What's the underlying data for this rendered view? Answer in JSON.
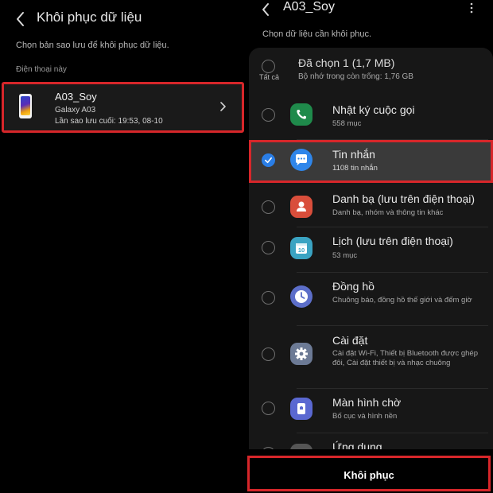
{
  "left": {
    "title": "Khôi phục dữ liệu",
    "subtitle": "Chọn bản sao lưu để khôi phục dữ liệu.",
    "section": "Điện thoại này",
    "device": {
      "name": "A03_Soy",
      "model": "Galaxy A03",
      "last_backup": "Lần sao lưu cuối: 19:53, 08-10"
    }
  },
  "right": {
    "title": "A03_Soy",
    "subtitle": "Chọn dữ liệu cần khôi phục.",
    "select_all": {
      "label": "Tất cả",
      "title": "Đã chọn 1 (1,7 MB)",
      "desc": "Bộ nhớ trong còn trống: 1,76 GB"
    },
    "items": [
      {
        "title": "Nhật ký cuộc gọi",
        "desc": "558 mục",
        "checked": false,
        "icon": "phone-icon",
        "color": "#1f8a4b"
      },
      {
        "title": "Tin nhắn",
        "desc": "1108 tin nhắn",
        "checked": true,
        "icon": "message-icon",
        "color": "#2f86ea"
      },
      {
        "title": "Danh bạ (lưu trên điện thoại)",
        "desc": "Danh bạ, nhóm và thông tin khác",
        "checked": false,
        "icon": "contacts-icon",
        "color": "#d94e3b"
      },
      {
        "title": "Lịch (lưu trên điện thoại)",
        "desc": "53 mục",
        "checked": false,
        "icon": "calendar-icon",
        "color": "#3aa3c2",
        "icon_text": "10"
      },
      {
        "title": "Đồng hồ",
        "desc": "Chuông báo, đồng hồ thế giới và đếm giờ",
        "checked": false,
        "icon": "clock-icon",
        "color": "#5c6ec9"
      },
      {
        "title": "Cài đặt",
        "desc": "Cài đặt Wi-Fi, Thiết bị Bluetooth được ghép đôi, Cài đặt thiết bị và nhạc chuông",
        "checked": false,
        "icon": "settings-icon",
        "color": "#6c7a95"
      },
      {
        "title": "Màn hình chờ",
        "desc": "Bố cục và hình nền",
        "checked": false,
        "icon": "home-screen-icon",
        "color": "#5a68d1"
      },
      {
        "title": "Ứng dụng",
        "desc": "",
        "checked": false,
        "icon": "apps-icon",
        "color": "#555555"
      }
    ],
    "restore_label": "Khôi phục"
  },
  "colors": {
    "highlight_border": "#d7262a",
    "accent_blue": "#2a7ee6"
  }
}
